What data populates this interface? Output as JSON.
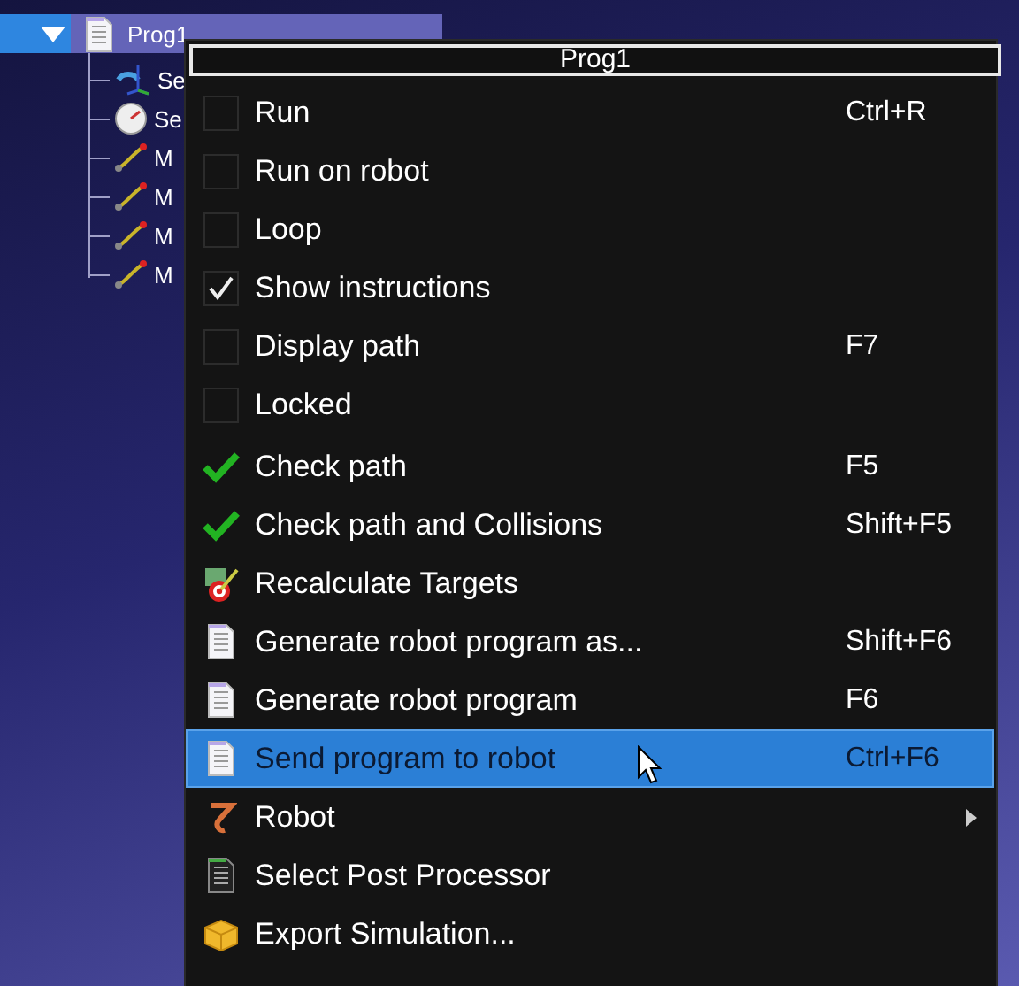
{
  "tree": {
    "program": {
      "label": "Prog1",
      "selected": true,
      "expanded": true
    },
    "children": [
      {
        "label": "Se"
      },
      {
        "label": "Se"
      },
      {
        "label": "M"
      },
      {
        "label": "M"
      },
      {
        "label": "M"
      },
      {
        "label": "M"
      }
    ]
  },
  "menu": {
    "title": "Prog1",
    "items": [
      {
        "kind": "checkbox",
        "label": "Run",
        "shortcut": "Ctrl+R",
        "checked": false,
        "selected": false
      },
      {
        "kind": "checkbox",
        "label": "Run on robot",
        "checked": false,
        "selected": false
      },
      {
        "kind": "checkbox",
        "label": "Loop",
        "checked": false,
        "selected": false
      },
      {
        "kind": "checkbox",
        "label": "Show instructions",
        "checked": true,
        "selected": false
      },
      {
        "kind": "checkbox",
        "label": "Display path",
        "shortcut": "F7",
        "checked": false,
        "selected": false
      },
      {
        "kind": "checkbox",
        "label": "Locked",
        "checked": false,
        "selected": false
      },
      {
        "kind": "separator"
      },
      {
        "kind": "action",
        "label": "Check path",
        "shortcut": "F5",
        "selected": false
      },
      {
        "kind": "action",
        "label": "Check path and Collisions",
        "shortcut": "Shift+F5",
        "selected": false
      },
      {
        "kind": "action",
        "label": "Recalculate Targets",
        "selected": false
      },
      {
        "kind": "action",
        "label": "Generate robot program as...",
        "shortcut": "Shift+F6",
        "selected": false
      },
      {
        "kind": "action",
        "label": "Generate robot program",
        "shortcut": "F6",
        "selected": false
      },
      {
        "kind": "action",
        "label": "Send program to robot",
        "shortcut": "Ctrl+F6",
        "selected": true
      },
      {
        "kind": "submenu",
        "label": "Robot",
        "selected": false
      },
      {
        "kind": "action",
        "label": "Select Post Processor",
        "selected": false
      },
      {
        "kind": "action",
        "label": "Export Simulation...",
        "selected": false
      }
    ]
  }
}
